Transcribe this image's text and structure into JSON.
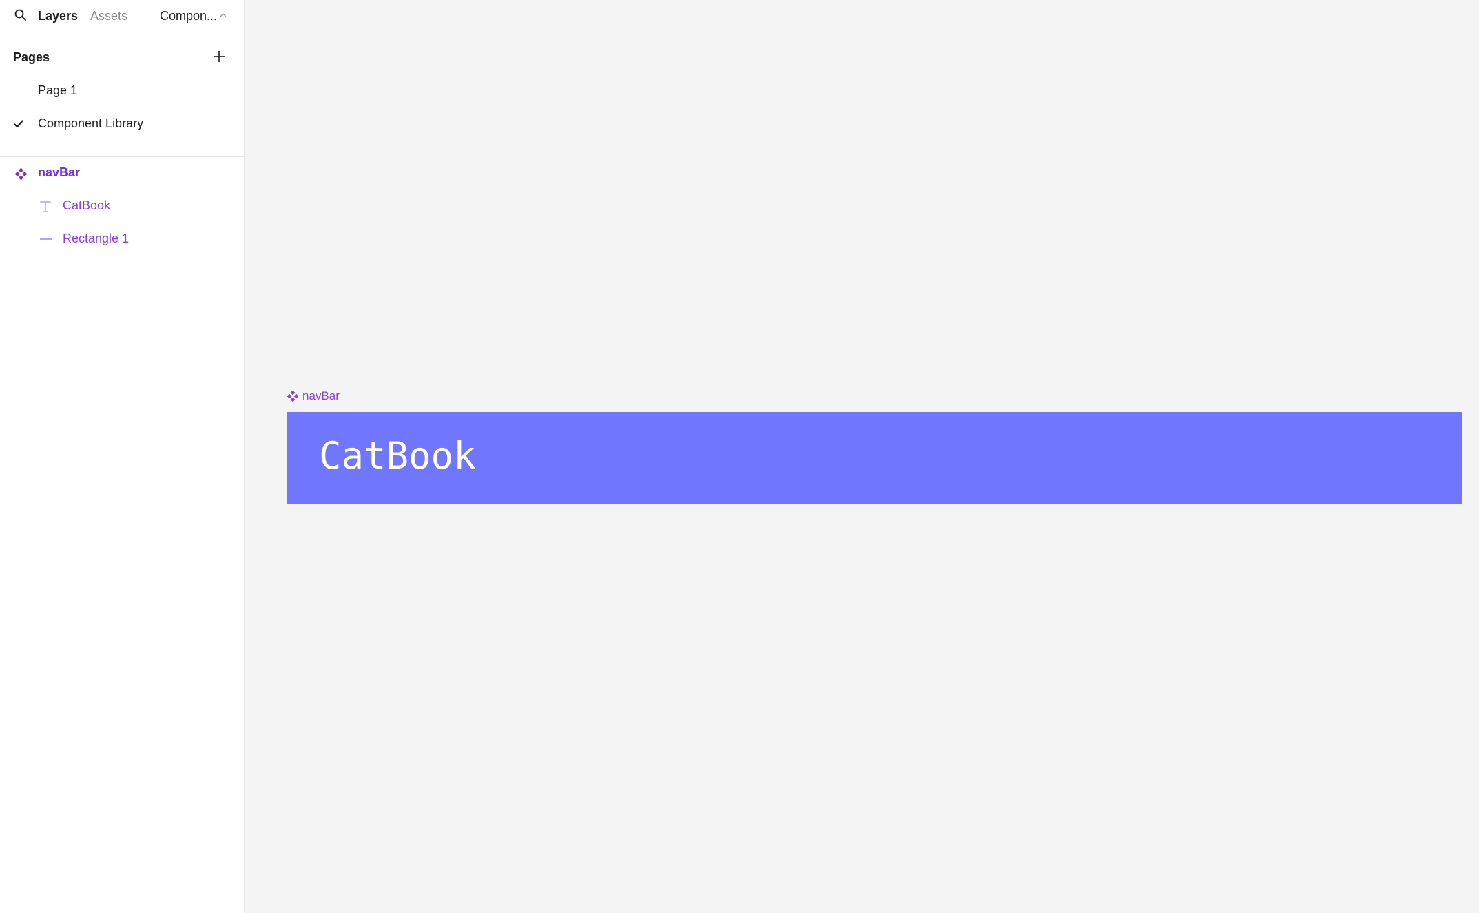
{
  "topbar": {
    "tabs": [
      {
        "label": "Layers",
        "active": true
      },
      {
        "label": "Assets",
        "active": false
      }
    ],
    "page_switcher": "Compon..."
  },
  "pages": {
    "title": "Pages",
    "items": [
      {
        "label": "Page 1",
        "selected": false
      },
      {
        "label": "Component Library",
        "selected": true
      }
    ]
  },
  "layers": {
    "items": [
      {
        "label": "navBar",
        "type": "component"
      },
      {
        "label": "CatBook",
        "type": "text"
      },
      {
        "label": "Rectangle 1",
        "type": "rectangle"
      }
    ]
  },
  "canvas": {
    "frame_label": "navBar",
    "navbar_text": "CatBook"
  },
  "colors": {
    "accent": "#8a3fe0",
    "navbar_fill": "#7176ff",
    "canvas_bg": "#f4f4f4"
  }
}
